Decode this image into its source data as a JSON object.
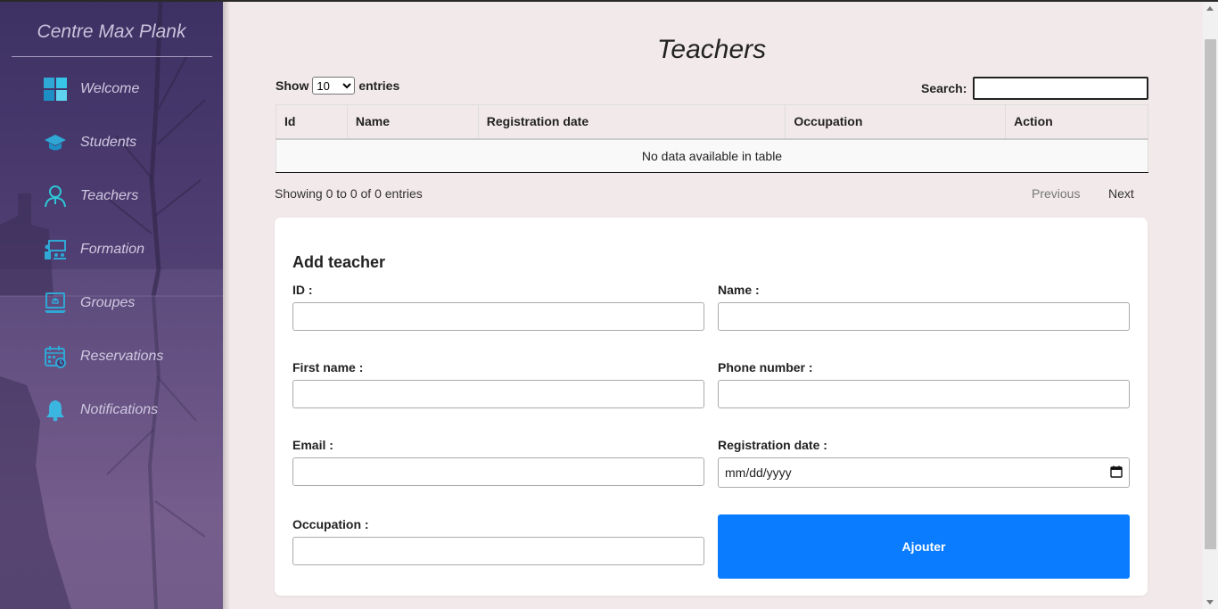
{
  "sidebar": {
    "title": "Centre Max Plank",
    "items": [
      {
        "label": "Welcome",
        "icon": "dashboard-icon"
      },
      {
        "label": "Students",
        "icon": "graduation-cap-icon"
      },
      {
        "label": "Teachers",
        "icon": "user-icon"
      },
      {
        "label": "Formation",
        "icon": "presentation-icon"
      },
      {
        "label": "Groupes",
        "icon": "laptop-icon"
      },
      {
        "label": "Reservations",
        "icon": "calendar-icon"
      },
      {
        "label": "Notifications",
        "icon": "bell-icon"
      }
    ]
  },
  "page": {
    "title": "Teachers"
  },
  "table_controls": {
    "show_label": "Show",
    "entries_value": "10",
    "entries_label": "entries",
    "search_label": "Search:"
  },
  "table": {
    "columns": [
      "Id",
      "Name",
      "Registration date",
      "Occupation",
      "Action"
    ],
    "empty_message": "No data available in table",
    "info": "Showing 0 to 0 of 0 entries",
    "prev_label": "Previous",
    "next_label": "Next"
  },
  "form": {
    "title": "Add teacher",
    "id_label": "ID :",
    "name_label": "Name :",
    "first_name_label": "First name :",
    "phone_label": "Phone number :",
    "email_label": "Email :",
    "registration_label": "Registration date :",
    "registration_placeholder": "mm/dd/yyyy",
    "occupation_label": "Occupation :",
    "submit_label": "Ajouter"
  },
  "colors": {
    "accent": "#0a7cff",
    "background": "#f2e9ea",
    "sidebar": "#4a3a6e",
    "icon": "#2fa8d6"
  }
}
